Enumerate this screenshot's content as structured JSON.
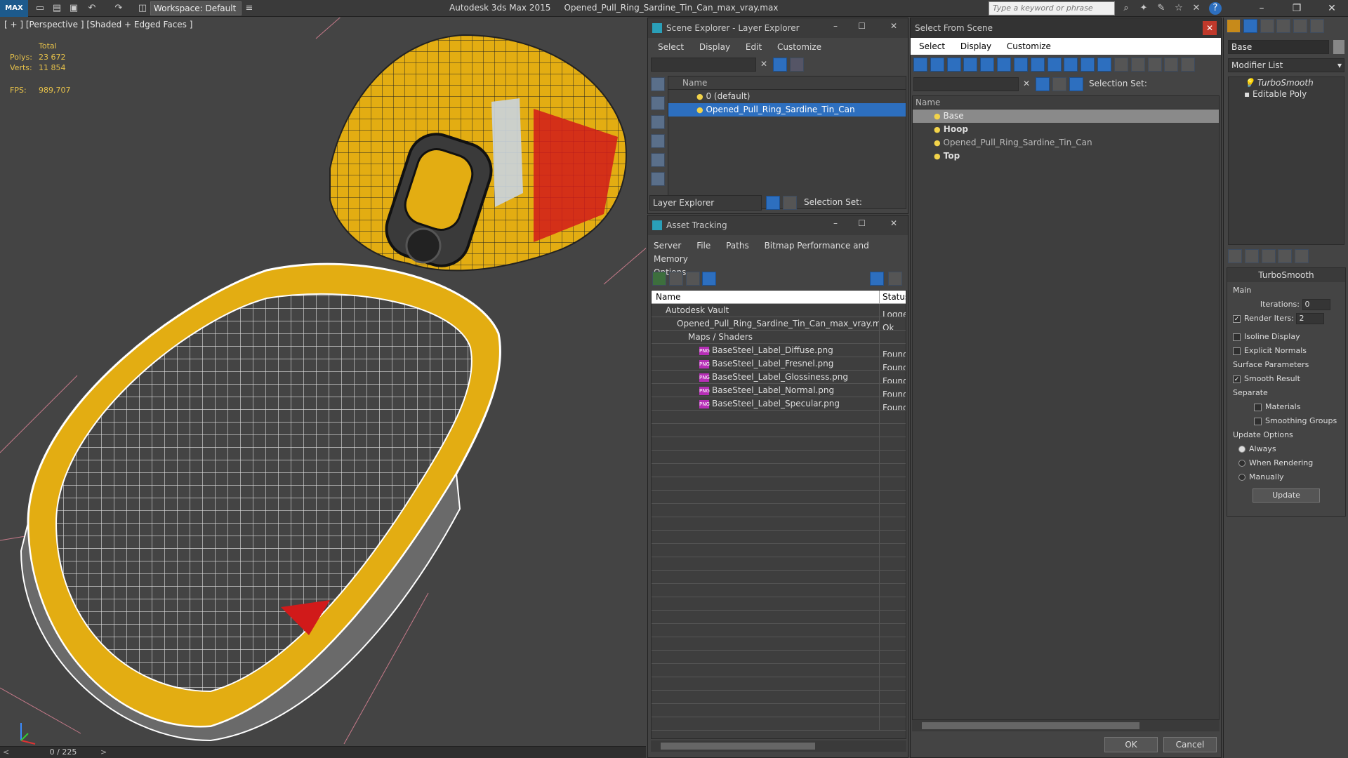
{
  "titlebar": {
    "logo": "MAX",
    "workspace": "Workspace: Default",
    "app_title": "Autodesk 3ds Max  2015",
    "file_title": "Opened_Pull_Ring_Sardine_Tin_Can_max_vray.max",
    "search_placeholder": "Type a keyword or phrase"
  },
  "viewport": {
    "label": "[ + ] [Perspective ] [Shaded + Edged Faces ]",
    "stats": {
      "total_label": "Total",
      "polys_label": "Polys:",
      "polys": "23 672",
      "verts_label": "Verts:",
      "verts": "11 854",
      "fps_label": "FPS:",
      "fps": "989,707"
    },
    "frame": "0 / 225",
    "colors": {
      "can_yellow": "#e3ad12",
      "wire": "#ffffff",
      "label_red": "#d11a1a",
      "background": "#444444"
    }
  },
  "scene_explorer": {
    "title": "Scene Explorer - Layer Explorer",
    "menu": [
      "Select",
      "Display",
      "Edit",
      "Customize"
    ],
    "col_name": "Name",
    "rows": [
      "0 (default)",
      "Opened_Pull_Ring_Sardine_Tin_Can"
    ],
    "footer_dropdown": "Layer Explorer",
    "selection_set": "Selection Set:"
  },
  "asset_tracking": {
    "title": "Asset Tracking",
    "menu": [
      "Server",
      "File",
      "Paths",
      "Bitmap Performance and Memory",
      "Options"
    ],
    "col_name": "Name",
    "col_status": "Status",
    "rows": [
      {
        "name": "Autodesk Vault",
        "status": "Logge"
      },
      {
        "name": "Opened_Pull_Ring_Sardine_Tin_Can_max_vray.m...",
        "status": "Ok"
      },
      {
        "name": "Maps / Shaders",
        "status": ""
      },
      {
        "name": "BaseSteel_Label_Diffuse.png",
        "status": "Found"
      },
      {
        "name": "BaseSteel_Label_Fresnel.png",
        "status": "Found"
      },
      {
        "name": "BaseSteel_Label_Glossiness.png",
        "status": "Found"
      },
      {
        "name": "BaseSteel_Label_Normal.png",
        "status": "Found"
      },
      {
        "name": "BaseSteel_Label_Specular.png",
        "status": "Found"
      }
    ]
  },
  "select_from_scene": {
    "title": "Select From Scene",
    "menu": [
      "Select",
      "Display",
      "Customize"
    ],
    "selection_set": "Selection Set:",
    "col_name": "Name",
    "rows": [
      "Base",
      "Hoop",
      "Opened_Pull_Ring_Sardine_Tin_Can",
      "Top"
    ],
    "ok": "OK",
    "cancel": "Cancel"
  },
  "modifier_panel": {
    "object_name": "Base",
    "modifier_list": "Modifier List",
    "stack": [
      "TurboSmooth",
      "Editable Poly"
    ],
    "rollout_title": "TurboSmooth",
    "main_label": "Main",
    "iterations_label": "Iterations:",
    "iterations": "0",
    "render_iters_label": "Render Iters:",
    "render_iters": "2",
    "isoline": "Isoline Display",
    "explicit": "Explicit Normals",
    "surface_label": "Surface Parameters",
    "smooth_result": "Smooth Result",
    "separate_label": "Separate",
    "materials": "Materials",
    "smoothing_groups": "Smoothing Groups",
    "update_label": "Update Options",
    "always": "Always",
    "when_rendering": "When Rendering",
    "manually": "Manually",
    "update_btn": "Update"
  }
}
